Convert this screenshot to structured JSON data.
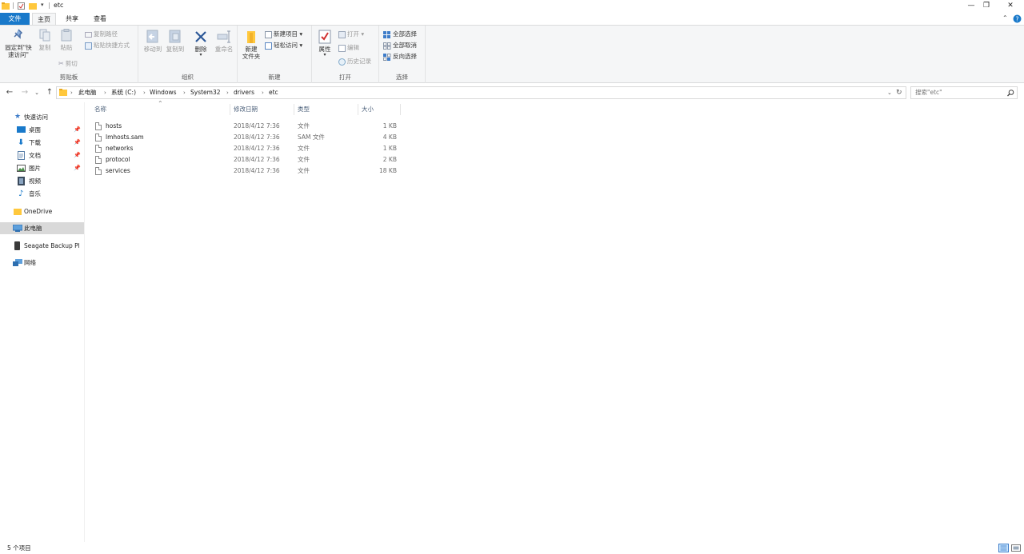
{
  "titlebar": {
    "title": "etc",
    "minimize": "—",
    "restore": "❐",
    "close": "✕"
  },
  "tabs": [
    {
      "label": "文件"
    },
    {
      "label": "主页"
    },
    {
      "label": "共享"
    },
    {
      "label": "查看"
    }
  ],
  "ribbon": {
    "clipboard": {
      "title": "剪贴板",
      "pin": "固定到\"快\n速访问\"",
      "copy": "复制",
      "paste": "粘贴",
      "copy_path": "复制路径",
      "paste_shortcut": "粘贴快捷方式",
      "cut": "剪切"
    },
    "organize": {
      "title": "组织",
      "move_to": "移动到",
      "copy_to": "复制到",
      "delete": "删除",
      "rename": "重命名"
    },
    "new": {
      "title": "新建",
      "new_folder": "新建\n文件夹",
      "new_item": "新建项目 ▾",
      "easy_access": "轻松访问 ▾"
    },
    "open": {
      "title": "打开",
      "properties": "属性",
      "open": "打开 ▾",
      "edit": "编辑",
      "history": "历史记录"
    },
    "select": {
      "title": "选择",
      "select_all": "全部选择",
      "select_none": "全部取消",
      "invert": "反向选择"
    }
  },
  "address": {
    "crumbs": [
      "此电脑",
      "系统 (C:)",
      "Windows",
      "System32",
      "drivers",
      "etc"
    ],
    "search_placeholder": "搜索\"etc\""
  },
  "nav": {
    "quick_access": "快速访问",
    "items": [
      {
        "label": "桌面"
      },
      {
        "label": "下载"
      },
      {
        "label": "文档"
      },
      {
        "label": "图片"
      },
      {
        "label": "视频"
      },
      {
        "label": "音乐"
      }
    ],
    "onedrive": "OneDrive",
    "this_pc": "此电脑",
    "seagate": "Seagate Backup Pl",
    "network": "网络"
  },
  "columns": {
    "name": "名称",
    "date": "修改日期",
    "type": "类型",
    "size": "大小"
  },
  "files": [
    {
      "name": "hosts",
      "date": "2018/4/12 7:36",
      "type": "文件",
      "size": "1 KB"
    },
    {
      "name": "lmhosts.sam",
      "date": "2018/4/12 7:36",
      "type": "SAM 文件",
      "size": "4 KB"
    },
    {
      "name": "networks",
      "date": "2018/4/12 7:36",
      "type": "文件",
      "size": "1 KB"
    },
    {
      "name": "protocol",
      "date": "2018/4/12 7:36",
      "type": "文件",
      "size": "2 KB"
    },
    {
      "name": "services",
      "date": "2018/4/12 7:36",
      "type": "文件",
      "size": "18 KB"
    }
  ],
  "status": {
    "count": "5 个项目"
  },
  "colors": {
    "accent": "#1979ca",
    "folder": "#ffc83d",
    "selection": "#d9d9d9"
  }
}
